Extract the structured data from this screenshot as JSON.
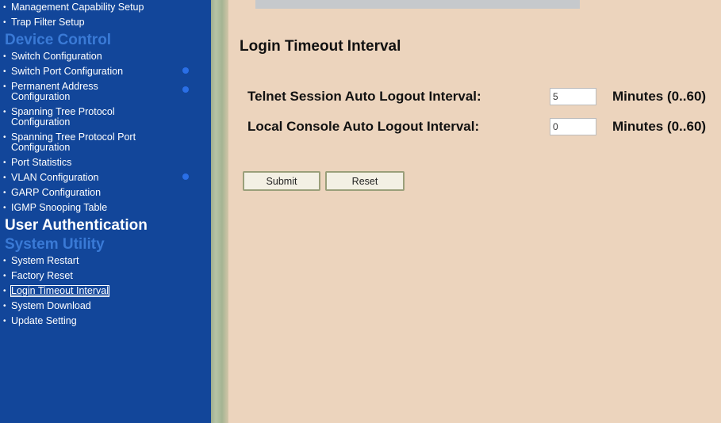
{
  "sidebar": {
    "top_items": [
      {
        "label": "Management Capability Setup"
      },
      {
        "label": "Trap Filter Setup"
      }
    ],
    "device_control": {
      "header": "Device Control",
      "items": [
        {
          "label": "Switch Configuration"
        },
        {
          "label": "Switch Port Configuration"
        },
        {
          "label": "Permanent Address Configuration"
        },
        {
          "label": "Spanning Tree Protocol Configuration"
        },
        {
          "label": "Spanning Tree Protocol Port Configuration"
        },
        {
          "label": "Port Statistics"
        },
        {
          "label": "VLAN Configuration"
        },
        {
          "label": "GARP Configuration"
        },
        {
          "label": "IGMP Snooping Table"
        }
      ]
    },
    "user_authentication": {
      "header": "User Authentication"
    },
    "system_utility": {
      "header": "System Utility",
      "items": [
        {
          "label": "System Restart"
        },
        {
          "label": "Factory Reset"
        },
        {
          "label": "Login Timeout Interval"
        },
        {
          "label": "System Download"
        },
        {
          "label": "Update Setting"
        }
      ]
    },
    "bullet": "•"
  },
  "main": {
    "title": "Login Timeout Interval",
    "telnet": {
      "label": "Telnet Session Auto Logout Interval:",
      "value": "5",
      "unit": "Minutes (0..60)"
    },
    "console": {
      "label": "Local Console Auto Logout Interval:",
      "value": "0",
      "unit": "Minutes (0..60)"
    },
    "submit_label": "Submit",
    "reset_label": "Reset"
  },
  "colors": {
    "sidebar_bg": "#12469a",
    "page_bg": "#ecd4bd",
    "inactive_header": "#3a7ad6",
    "active_header": "#ffffff"
  }
}
